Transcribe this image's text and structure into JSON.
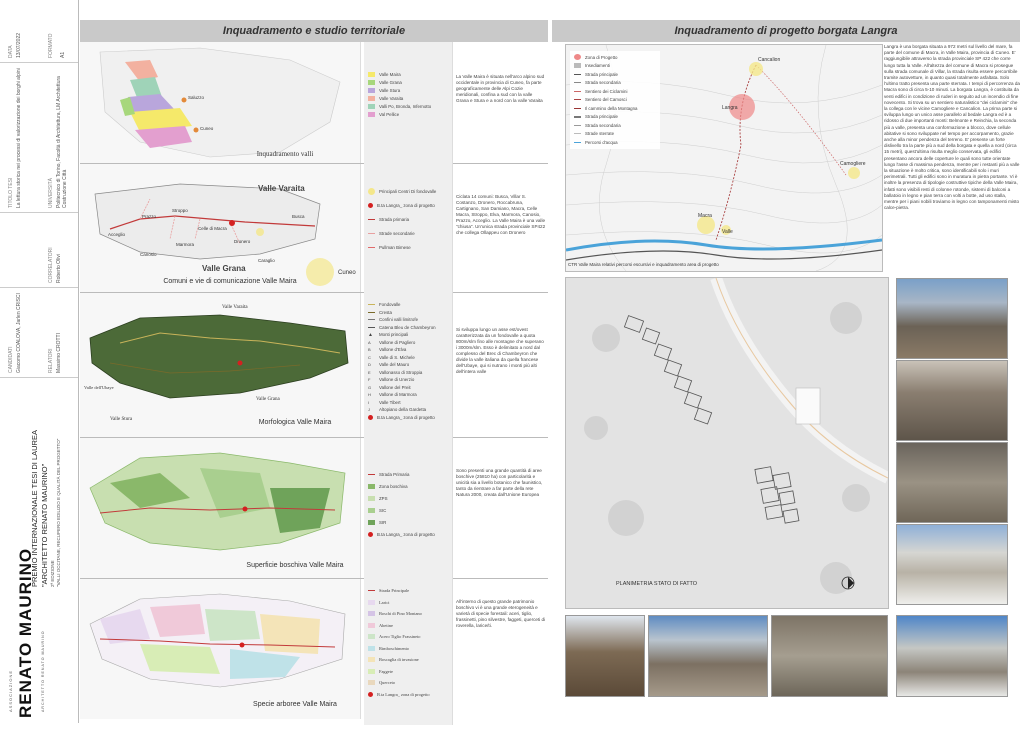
{
  "sidebar": {
    "date_label": "DATA",
    "date_value": "13/07/2022",
    "format_label": "FORMATO",
    "format_value": "A1",
    "title_label": "TITOLO TESI",
    "title_value": "La lettura storica nei processi di valorizzazione dei borghi alpini",
    "university_label": "UNIVERSITÀ",
    "university_value": "Politecnico di Torino, Facoltà di Architettura, LM Architettura Costruzione Città",
    "correlatori_label": "CORRELATORI",
    "correlatori_value": "Roberto Olivi",
    "candidati_label": "CANDIDATI",
    "candidati_value": "Giacomo COALOVA, Jarlen CRISCI",
    "relatori_label": "RELATORI",
    "relatori_value": "Massimo CROTTI",
    "award_title": "PREMIO INTERNAZIONALE TESI DI LAUREA",
    "award_name": "\"ARCHITETTO RENATO MAURINO\"",
    "award_edition": "2ª EDIZIONE",
    "award_sub": "\"VALLI OCCITANE, RECUPERO EDILIZIO E QUALITÀ DEL PROGETTO\"",
    "assoc_small": "ASSOCIAZIONE",
    "assoc_logo": "RENATO MAURINO",
    "assoc_sub": "ARCHITETTO RENATO MAURINO"
  },
  "left_section": {
    "header": "Inquadramento e studio territoriale",
    "panels": [
      {
        "caption": "Inquadramento valli",
        "map_labels": [
          "Saluzzo",
          "Cuneo"
        ],
        "legend": [
          {
            "label": "Valle Maira",
            "color": "#f5e96a"
          },
          {
            "label": "Valle Grana",
            "color": "#a7d77c"
          },
          {
            "label": "Valle Stura",
            "color": "#b9a6dc"
          },
          {
            "label": "Valle Varaita",
            "color": "#f3b1a0"
          },
          {
            "label": "Valli Po, Bronda, Infernotto",
            "color": "#9fd3b8"
          },
          {
            "label": "Val Pellice",
            "color": "#e39fcf"
          }
        ],
        "description": "La Valle Maira è situata nell'arco alpino sud occidentale in provincia di Cuneo, fa parte geograficamente delle Alpi Cozie meridionali, confina a sud con la valle Grana e Stura e a nord con la valle Varaita"
      },
      {
        "caption": "Comuni  e vie di comunicazione Valle Maira",
        "map_labels": [
          "Valle Varaita",
          "Valle Grana",
          "Cuneo",
          "Acceglio",
          "Prazzo",
          "Stroppo",
          "Marmora",
          "Canosio",
          "Dronero",
          "Caraglio",
          "Busca",
          "Celle di Macra"
        ],
        "legend": [
          {
            "label": "Principali Centri Di fondovalle",
            "color": "#f4e78a"
          },
          {
            "label": "B.ta Langra_ zona di progetto",
            "color": "#d42020"
          },
          {
            "label": "Strada primaria",
            "color": "#c23a3a"
          },
          {
            "label": "Strade secondarie",
            "color": "#e8a0a0"
          },
          {
            "label": "Pullman Bimese",
            "color": "#e06a6a"
          }
        ],
        "description": "Ciclata 14 comuni: Busca, Villar S. Costanzo, Dronero, Roccabruna, Cartignano, San Damiano, Macra, Celle Macra, Stroppo, Elva, Marmora, Canosio, Prazzo, Acceglio. La Valle Maira è una valle \"chiusa\". Un'unica strada provinciale SP422 che collega Ollappeu con Dronero"
      },
      {
        "caption": "Morfologica  Valle Maira",
        "map_labels": [
          "Valle Varaita",
          "Valle dell'Ubaye",
          "Valle Grana",
          "Valle Stura"
        ],
        "legend": [
          {
            "label": "Fondovalle",
            "color": "#c9b45a"
          },
          {
            "label": "Cresta",
            "color": "#7a6a2a"
          },
          {
            "label": "Confini valli limitrofe",
            "color": "#777777"
          },
          {
            "label": "Catena Bleu de Chambeyron",
            "color": "#555555"
          },
          {
            "label": "Monti principali",
            "color": "#444444"
          },
          {
            "label": "Vallone di Pagliero",
            "color": "#555555"
          },
          {
            "label": "Vallone d'Elva",
            "color": "#555555"
          },
          {
            "label": "Valle di S. Michele",
            "color": "#555555"
          },
          {
            "label": "Valle del Mauro",
            "color": "#555555"
          },
          {
            "label": "Vallonasso di Stroppia",
            "color": "#555555"
          },
          {
            "label": "Vallone di Unerzio",
            "color": "#555555"
          },
          {
            "label": "Vallone del Preit",
            "color": "#555555"
          },
          {
            "label": "Vallone di Marmora",
            "color": "#555555"
          },
          {
            "label": "Valle Tibert",
            "color": "#555555"
          },
          {
            "label": "Altopiano della Gardetta",
            "color": "#555555"
          },
          {
            "label": "B.ta Langra_ zona di progetto",
            "color": "#d42020"
          }
        ],
        "description": "Si sviluppa lungo un asse est/ovest caratterizzata da un fondovalle a quota 800m/slm fino alle montagne che superano i 3000m/slm. Esso è delimitato a nord dal complesso del Brec di Chambeyron che divide la valle italiana da quella francese dell'Ubaye, qui si nutrano i monti più alti dell'intera valle"
      },
      {
        "caption": "Superficie boschiva Valle Maira",
        "map_labels": [],
        "legend": [
          {
            "label": "Strada Primaria",
            "color": "#c23a3a"
          },
          {
            "label": "Zona boschiva",
            "color": "#8ab86a"
          },
          {
            "label": "ZPS",
            "color": "#c8dfb0"
          },
          {
            "label": "SIC",
            "color": "#a9cf8f"
          },
          {
            "label": "SIR",
            "color": "#6fa35a"
          },
          {
            "label": "B.ta Langra_ zona di progetto",
            "color": "#d42020"
          }
        ],
        "description": "Sono presenti una grande quantità di aree boschive (25810 ha) con particolarità e unicità sia a livello botanico che faunistico, tanto da rientrare a far parte della rete Natura 2000, creata dall'Unione Europea"
      },
      {
        "caption": "Specie arboree Valle Maira",
        "map_labels": [],
        "legend": [
          {
            "label": "Strada Principale",
            "color": "#c23a3a"
          },
          {
            "label": "Larici",
            "color": "#e7d9ef"
          },
          {
            "label": "Boschi di Pino Montano",
            "color": "#d5c4e6"
          },
          {
            "label": "Abetine",
            "color": "#f0c9d9"
          },
          {
            "label": "Acero Tiglio Frassineto",
            "color": "#cde5c8"
          },
          {
            "label": "Rimboschimento",
            "color": "#bfe2e8"
          },
          {
            "label": "Boscaglia di invasione",
            "color": "#f4e4b8"
          },
          {
            "label": "Faggete",
            "color": "#d8edb6"
          },
          {
            "label": "Querceto",
            "color": "#e9d8bd"
          },
          {
            "label": "B.ta Langra_ zona di progetto",
            "color": "#d42020"
          }
        ],
        "description": "All'interno di questo grande patrimonio boschivo vi è una grande eterogeneità e varietà di specie forestali: aceri, tiglio, frassinetti, pino silvestre, faggeti, querceti di roverella, larice/ti."
      }
    ]
  },
  "right_section": {
    "header": "Inquadramento di progetto borgata Langra",
    "ctr_caption": "CTR Valle Maira relativi percorsi escursivi e inquadramento area di progetto",
    "ctr_labels": [
      "Cancalion",
      "Langra",
      "Camogliere",
      "Macra",
      "Valle"
    ],
    "ctr_legend": [
      {
        "label": "Zona di Progetto",
        "color": "#e88"
      },
      {
        "label": "Insediamenti",
        "color": "#bbb"
      },
      {
        "label": "Strada principale",
        "color": "#555"
      },
      {
        "label": "Strada secondaria",
        "color": "#888"
      },
      {
        "label": "Sentiero dei Ciclamini",
        "color": "#c66"
      },
      {
        "label": "Sentiero del Camosci",
        "color": "#a44"
      },
      {
        "label": "Il cammino della Montagna",
        "color": "#933"
      },
      {
        "label": "Strada principale",
        "color": "#777"
      },
      {
        "label": "Strada secondaria",
        "color": "#999"
      },
      {
        "label": "Strade sterrate",
        "color": "#bbb"
      },
      {
        "label": "Percorsi d'acqua",
        "color": "#4aa3d9"
      }
    ],
    "plan_caption": "PLANIMETRIA STATO DI FATTO",
    "text": "Langra è una borgata situata a 972 metri sul livello del mare, fa parte del comune di Macra, in Valle Maira, provincia di Cuneo. E' raggiungibile attraverso la strada provinciale SP 422 che corre lungo tutta la Valle. All'altezza del comune di Macra si prosegue sulla strada comunale di Villar, la strada risulta essere percorribile tramite autovetture, in quanto quasi totalmente asfaltata. Solo l'ultimo tratto presenta una parte sterrata. I tempi di percorrenza da Macra sono di circa 5-10 minuti. La borgata Langra, è costituita da venti edifici in condizione di ruderi in seguito ad un incendio di fine novecento. Si trova su un sentiero naturalistico \"dei ciclamini\" che la collega con le vicine Camogliere e Cancalion. La prima parte si sviluppa lungo un unico asse parallelo al bedale Langra ed è a ridosso di due importanti monti: Belmonte e Reinchia, la seconda più a valle, presenta una conformazione a blocco, dove cellule abitative si sono sviluppate nel tempo per accorpamento, grazie anche alla minor pendenza del terreno. E' presente un forte dislivello tra la parte più a sud della borgata e quella a nord (circa 15 metri), quest'ultima risulta meglio conservata, gli edifici presentano ancora delle coperture le quali sono tutte orientate lungo l'asse di massima pendenza, mentre per i restanti più a valle la situazione è molto critica, sono identificabili solo i muri perimetrali. Tutti gli edifici sono in muratura in pietra portante. Vi è inoltre la presenza di tipologie costruttive tipiche della Valle Maira, infatti sono visibili resti di colonne rotonde, sistemi di balconi a ballatoio in legno e pian terra con volti a botte, ad uso stalla, mentre per i piani nobili troviamo in legno con tamponamenti misto calce-pietra."
  }
}
